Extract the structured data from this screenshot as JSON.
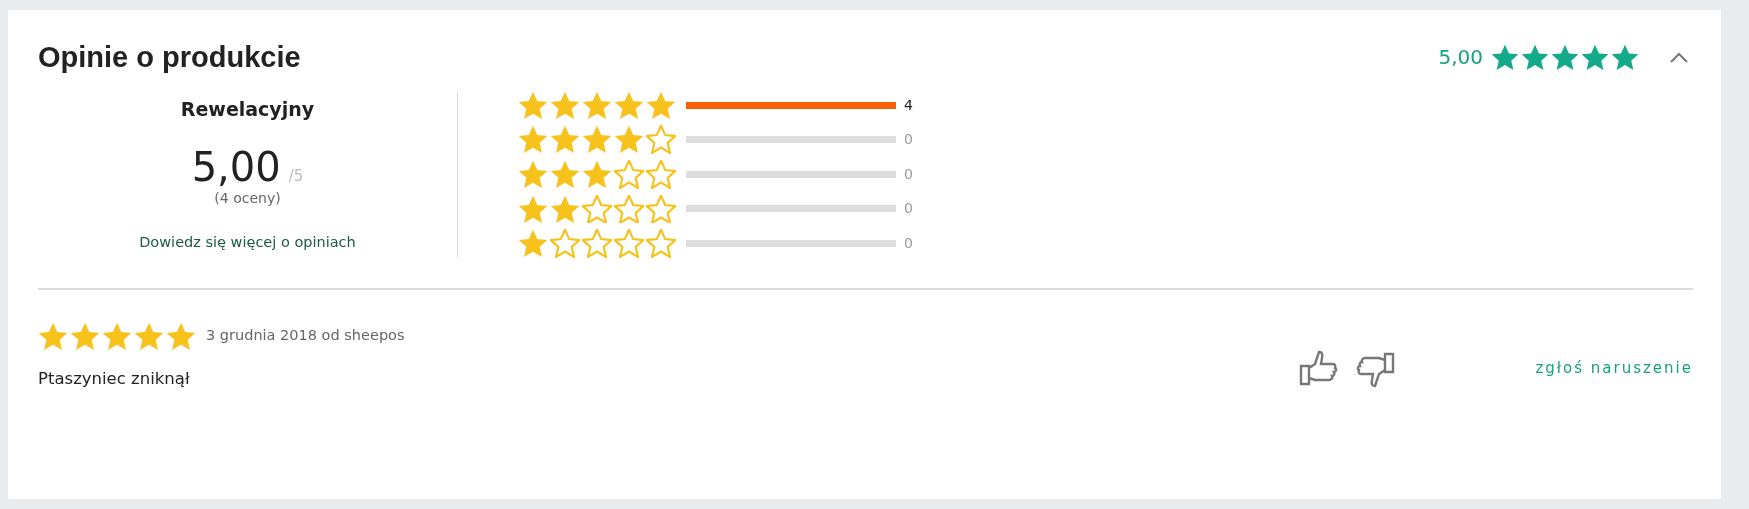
{
  "header": {
    "title": "Opinie o produkcie",
    "average": "5,00",
    "stars": 5,
    "expanded": true
  },
  "summary": {
    "verdict": "Rewelacyjny",
    "score": "5,00",
    "scale": "/5",
    "count": "(4 oceny)",
    "link": "Dowiedz się więcej o opiniach"
  },
  "distribution": [
    {
      "stars": 5,
      "level": 1,
      "count": "4"
    },
    {
      "stars": 4,
      "level": 0,
      "count": "0"
    },
    {
      "stars": 3,
      "level": 0,
      "count": "0"
    },
    {
      "stars": 2,
      "level": 0,
      "count": "0"
    },
    {
      "stars": 1,
      "level": 0,
      "count": "0"
    }
  ],
  "reviews": [
    {
      "stars": 5,
      "meta": "3 grudnia 2018 od sheepos",
      "text": "Ptaszyniec zniknął",
      "report": "zgłoś naruszenie"
    }
  ]
}
